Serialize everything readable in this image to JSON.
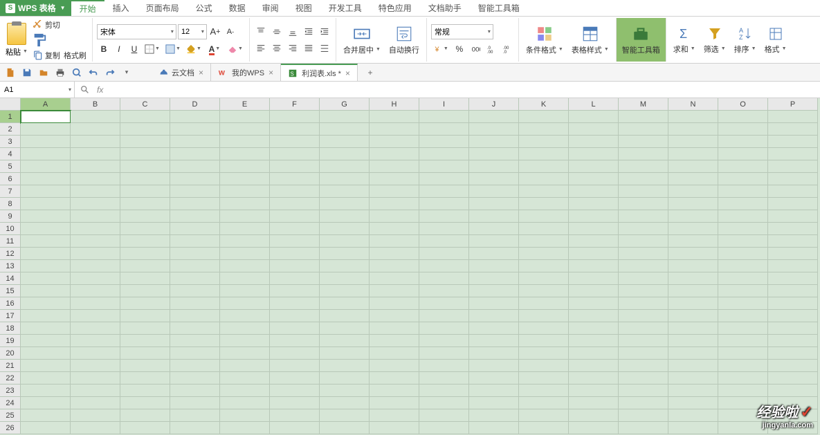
{
  "app": {
    "name": "WPS 表格"
  },
  "menu": {
    "tabs": [
      "开始",
      "插入",
      "页面布局",
      "公式",
      "数据",
      "审阅",
      "视图",
      "开发工具",
      "特色应用",
      "文档助手",
      "智能工具箱"
    ],
    "active": 0
  },
  "ribbon": {
    "paste": "粘贴",
    "cut": "剪切",
    "copy": "复制",
    "format_painter": "格式刷",
    "font_name": "宋体",
    "font_size": "12",
    "merge_center": "合并居中",
    "auto_wrap": "自动换行",
    "number_format": "常规",
    "cond_format": "条件格式",
    "table_style": "表格样式",
    "smart_tools": "智能工具箱",
    "sum": "求和",
    "filter": "筛选",
    "sort": "排序",
    "format": "格式"
  },
  "doc_tabs": {
    "items": [
      {
        "label": "云文档"
      },
      {
        "label": "我的WPS"
      },
      {
        "label": "利润表.xls *"
      }
    ],
    "active": 2
  },
  "name_box": "A1",
  "columns": [
    "A",
    "B",
    "C",
    "D",
    "E",
    "F",
    "G",
    "H",
    "I",
    "J",
    "K",
    "L",
    "M",
    "N",
    "O",
    "P"
  ],
  "row_count": 26,
  "active_cell": {
    "row": 0,
    "col": 0
  },
  "watermark": {
    "line1": "经验啦",
    "line2": "jingyanla.com"
  }
}
